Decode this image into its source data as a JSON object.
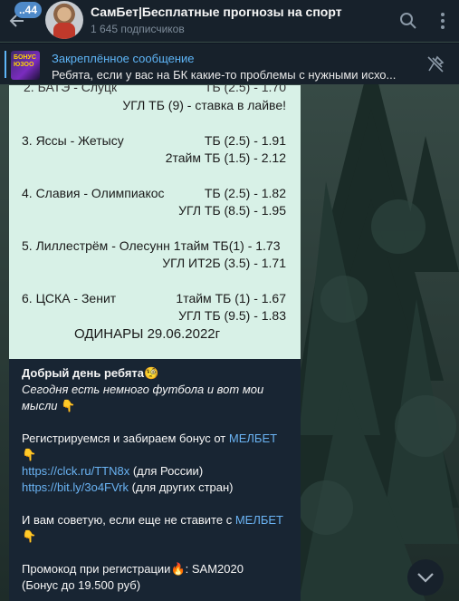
{
  "header": {
    "unread_count": "..44",
    "title": "СамБет|Бесплатные прогнозы на спорт",
    "subtitle": "1 645 подписчиков"
  },
  "pinned": {
    "title": "Закреплённое сообщение",
    "text": "Ребята, если у вас на БК какие-то проблемы с нужными исхо...",
    "thumb_text": "БОНУС\nЮЗОО"
  },
  "image_card": {
    "line_top_left": "2. БАТЭ - Слуцк",
    "line_top_right": "ТБ (2.5) - 1.70",
    "line_1b": "УГЛ ТБ (9) - ставка в лайве!",
    "m3_teams": "3. Яссы - Жетысу",
    "m3_bet1": "ТБ (2.5) - 1.91",
    "m3_bet2": "2тайм ТБ (1.5) - 2.12",
    "m4_teams": "4. Славия - Олимпиакос",
    "m4_bet1": "ТБ (2.5) - 1.82",
    "m4_bet2": "УГЛ ТБ (8.5) - 1.95",
    "m5_line1": "5. Лиллестрём - Олесунн 1тайм ТБ(1) - 1.73",
    "m5_bet2": "УГЛ ИТ2Б (3.5) - 1.71",
    "m6_teams": "6. ЦСКА - Зенит",
    "m6_bet1": "1тайм ТБ (1) - 1.67",
    "m6_bet2": "УГЛ ТБ (9.5) - 1.83",
    "footer": "ОДИНАРЫ 29.06.2022г"
  },
  "message": {
    "greeting": "Добрый день ребята",
    "italic_1": "Сегодня есть немного футбола и вот мои",
    "italic_2": "мысли",
    "register": "Регистрируемся и забираем бонус от",
    "brand": "МЕЛБЕТ",
    "link_ru": "https://clck.ru/TTN8x",
    "link_ru_note": " (для России)",
    "link_other": "https://bit.ly/3o4FVrk",
    "link_other_note": " (для других стран)",
    "advice": "И вам советую, если еще не ставите с",
    "promo_label": "Промокод при регистрации",
    "promo_code": ": SAM2020",
    "bonus": "(Бонус до 19.500 руб)"
  },
  "colors": {
    "accent": "#5eb5f7",
    "link": "#6ab3f3",
    "header_bg": "#17212b",
    "bubble_bg": "#182533",
    "card_bg": "#d8f1e7"
  },
  "icons": [
    "back-arrow-icon",
    "search-icon",
    "more-vertical-icon",
    "unpin-icon",
    "chevron-down-icon"
  ]
}
